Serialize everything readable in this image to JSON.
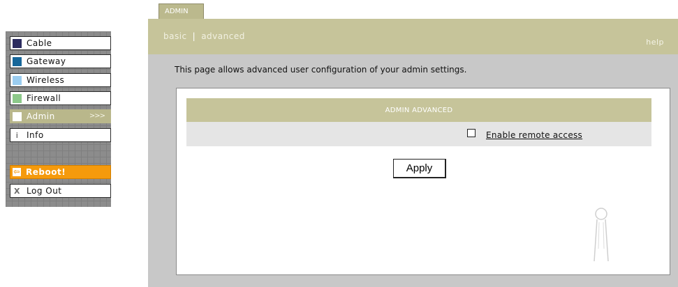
{
  "colors": {
    "accent_olive": "#c6c49a",
    "reboot_orange": "#f59a0c",
    "nav_grid_gray": "#8c8c8c",
    "frame_gray": "#c8c8c8",
    "cable": "#2b2b5e",
    "gateway": "#17679a",
    "wireless": "#9bcdf0",
    "firewall": "#8dc98a"
  },
  "nav": {
    "items": [
      {
        "label": "Cable",
        "swatch": "#2b2b5e"
      },
      {
        "label": "Gateway",
        "swatch": "#17679a"
      },
      {
        "label": "Wireless",
        "swatch": "#9bcdf0"
      },
      {
        "label": "Firewall",
        "swatch": "#8dc98a"
      },
      {
        "label": "Admin",
        "swatch": "#ffffff",
        "active": true,
        "chevron": ">>>"
      },
      {
        "label": "Info",
        "icon": "info-icon",
        "glyph": "i"
      }
    ],
    "reboot": {
      "label": "Reboot!",
      "icon": "reboot-arrow-icon",
      "glyph": "⇦"
    },
    "logout": {
      "label": "Log Out",
      "icon": "close-x-icon",
      "glyph": "X"
    }
  },
  "tab": {
    "label": "ADMIN"
  },
  "subnav": {
    "basic": "basic",
    "separator": "|",
    "advanced": "advanced"
  },
  "help": "help",
  "description": "This page allows advanced user configuration of your admin settings.",
  "section": {
    "title": "ADMIN ADVANCED",
    "remote_access": {
      "label": "Enable remote access",
      "checked": false
    }
  },
  "apply_label": "Apply",
  "watermark_icon": "antenna-icon"
}
